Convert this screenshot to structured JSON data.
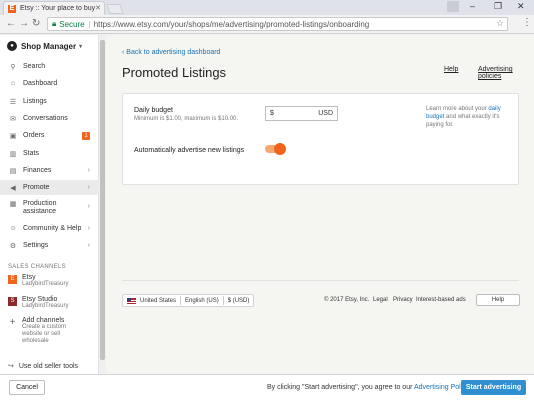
{
  "browser": {
    "tab_title": "Etsy :: Your place to buy",
    "tab_favicon": "E",
    "secure_label": "Secure",
    "url": "https://www.etsy.com/your/shops/me/advertising/promoted-listings/onboarding"
  },
  "sidebar": {
    "shop_manager": "Shop Manager",
    "items": [
      {
        "label": "Search",
        "icon": "search-icon"
      },
      {
        "label": "Dashboard",
        "icon": "home-icon"
      },
      {
        "label": "Listings",
        "icon": "listings-icon"
      },
      {
        "label": "Conversations",
        "icon": "mail-icon"
      },
      {
        "label": "Orders",
        "icon": "orders-icon",
        "badge": "1"
      },
      {
        "label": "Stats",
        "icon": "stats-icon"
      },
      {
        "label": "Finances",
        "icon": "finances-icon"
      },
      {
        "label": "Promote",
        "icon": "megaphone-icon"
      },
      {
        "label": "Production",
        "label2": "assistance",
        "icon": "production-icon"
      },
      {
        "label": "Community & Help",
        "icon": "community-icon"
      },
      {
        "label": "Settings",
        "icon": "gear-icon"
      }
    ],
    "sales_channels_heading": "SALES CHANNELS",
    "channels": [
      {
        "name": "Etsy",
        "sub": "LadybirdTreasury",
        "icon_letter": "E"
      },
      {
        "name": "Etsy Studio",
        "sub": "LadybirdTreasury",
        "icon_letter": "S"
      },
      {
        "name": "Add channels",
        "sub": "Create a custom website or sell wholesale"
      }
    ],
    "old_tools": "Use old seller tools"
  },
  "main": {
    "back_link": "Back to advertising dashboard",
    "title": "Promoted Listings",
    "help_link": "Help",
    "policies_link": "Advertising policies",
    "daily_budget_label": "Daily budget",
    "daily_budget_sub": "Minimum is $1.00, maximum is $10.00.",
    "budget_currency": "$",
    "budget_unit": "USD",
    "learn_pre": "Learn more about your",
    "learn_link": "daily budget",
    "learn_post": "and what exactly it's paying for.",
    "auto_label": "Automatically advertise new listings",
    "auto_enabled": true
  },
  "footer": {
    "country": "United States",
    "language": "English (US)",
    "currency": "$ (USD)",
    "copyright": "© 2017 Etsy, Inc.",
    "legal": "Legal",
    "privacy": "Privacy",
    "interest_ads": "Interest-based ads",
    "help": "Help"
  },
  "action_bar": {
    "cancel": "Cancel",
    "agree_pre": "By clicking \"Start advertising\", you agree to our",
    "agree_link": "Advertising Policies.",
    "start": "Start advertising"
  },
  "colors": {
    "etsy_orange": "#f1641e",
    "link_blue": "#1a73b5",
    "primary_button": "#2f8fd1"
  }
}
